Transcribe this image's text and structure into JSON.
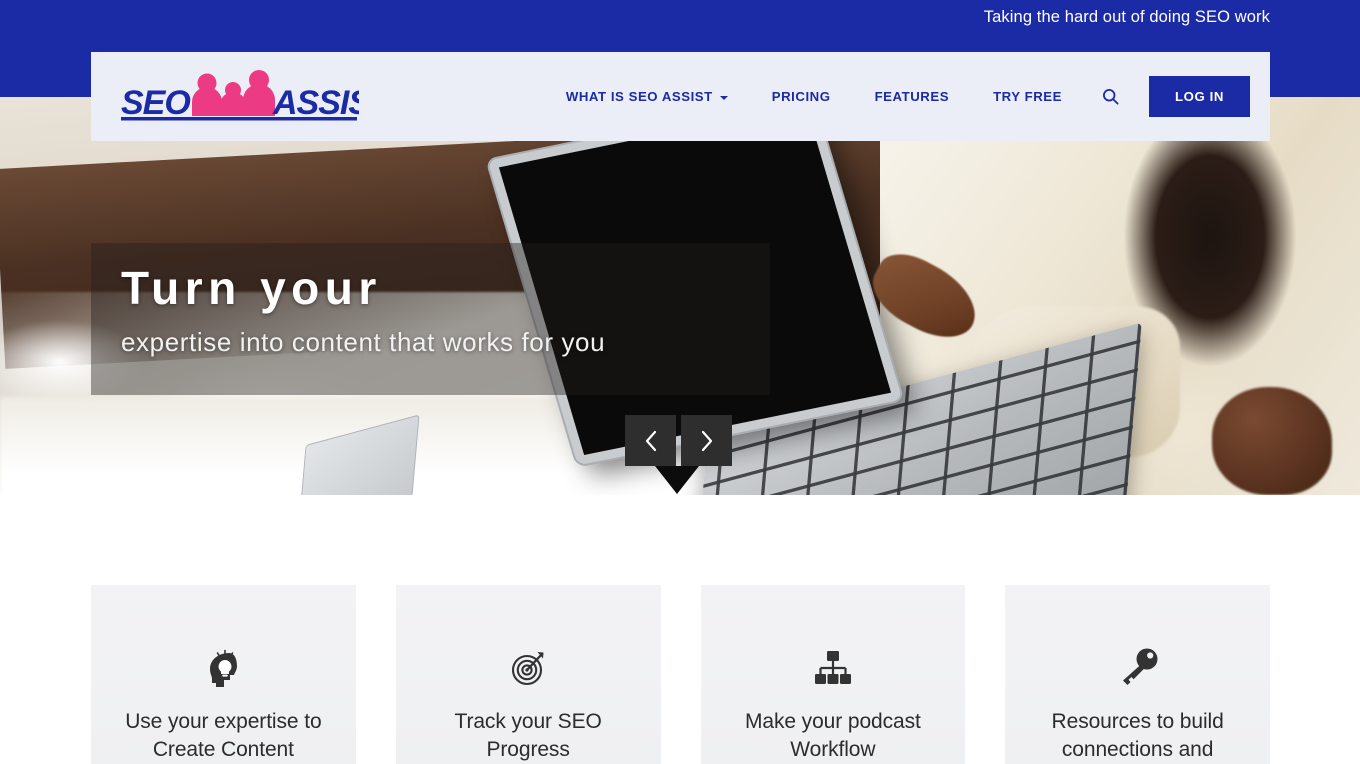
{
  "topbar": {
    "tagline": "Taking the hard out of doing SEO work",
    "bg_color": "#1b2ba5"
  },
  "brand": {
    "name_part1": "SEO",
    "name_part2": "ASSIST",
    "logo_text_color": "#1b2ba5",
    "logo_people_color": "#ec3a84"
  },
  "nav": {
    "items": [
      {
        "label": "WHAT IS SEO ASSIST",
        "has_dropdown": true
      },
      {
        "label": "PRICING",
        "has_dropdown": false
      },
      {
        "label": "FEATURES",
        "has_dropdown": false
      },
      {
        "label": "TRY FREE",
        "has_dropdown": false
      }
    ],
    "search_icon": "search-icon",
    "login_label": "LOG IN",
    "login_bg": "#1b2ba5",
    "link_color": "#1b2ba5"
  },
  "hero": {
    "headline": "Turn your",
    "subhead": "expertise into content that works for you",
    "prev_icon": "chevron-left-icon",
    "next_icon": "chevron-right-icon",
    "overlay_color": "rgba(35,30,28,0.42)"
  },
  "features": [
    {
      "icon": "head-lightbulb-icon",
      "title": "Use your expertise to Create Content"
    },
    {
      "icon": "target-dartboard-icon",
      "title": "Track your SEO Progress"
    },
    {
      "icon": "workflow-hierarchy-icon",
      "title": "Make your podcast Workflow"
    },
    {
      "icon": "key-icon",
      "title": "Resources to build connections and"
    }
  ]
}
